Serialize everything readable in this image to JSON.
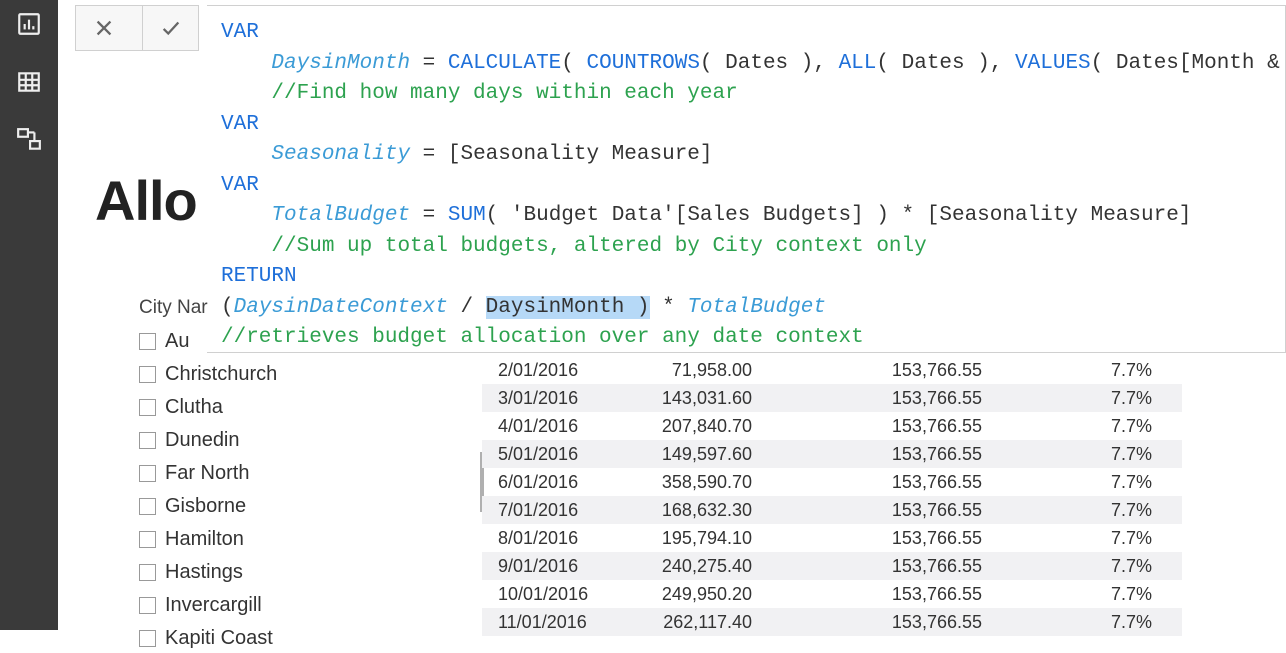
{
  "nav": {
    "report_icon": "report-icon",
    "data_icon": "data-icon",
    "model_icon": "model-icon"
  },
  "title": "Allo",
  "formula": {
    "line1_var": "VAR",
    "line2_ident": "DaysinMonth",
    "line2_eq": " = ",
    "line2_calc": "CALCULATE",
    "line2_p1": "( ",
    "line2_countrows": "COUNTROWS",
    "line2_p2": "( ",
    "line2_dates1": "Dates",
    "line2_p3": " ), ",
    "line2_all": "ALL",
    "line2_p4": "( ",
    "line2_dates2": "Dates",
    "line2_p5": " ), ",
    "line2_values": "VALUES",
    "line2_p6": "( ",
    "line2_dmref": "Dates[Month & Year]",
    "line2_end": " ) )",
    "line3_comment": "//Find how many days within each year",
    "line4_var": "VAR",
    "line5_ident": "Seasonality",
    "line5_eq": " = ",
    "line5_meas": "[Seasonality Measure]",
    "line6_var": "VAR",
    "line7_ident": "TotalBudget",
    "line7_eq": " = ",
    "line7_sum": "SUM",
    "line7_p1": "( ",
    "line7_ref": "'Budget Data'[Sales Budgets]",
    "line7_p2": " ) * ",
    "line7_meas": "[Seasonality Measure]",
    "line8_comment": "//Sum up total budgets, altered by City context only",
    "line9_return": "RETURN",
    "line10_p1": "(",
    "line10_a": "DaysinDateContext",
    "line10_div": " / ",
    "line10_b_hl": "DaysinMonth )",
    "line10_mul": " * ",
    "line10_c": "TotalBudget",
    "line11_comment": "//retrieves budget allocation over any date context"
  },
  "slicer": {
    "label": "City Nar",
    "items": [
      "Au",
      "Christchurch",
      "Clutha",
      "Dunedin",
      "Far North",
      "Gisborne",
      "Hamilton",
      "Hastings",
      "Invercargill",
      "Kapiti Coast"
    ]
  },
  "table": {
    "rows": [
      {
        "date": "2/01/2016",
        "v1": "71,958.00",
        "v2": "153,766.55",
        "v3": "7.7%"
      },
      {
        "date": "3/01/2016",
        "v1": "143,031.60",
        "v2": "153,766.55",
        "v3": "7.7%"
      },
      {
        "date": "4/01/2016",
        "v1": "207,840.70",
        "v2": "153,766.55",
        "v3": "7.7%"
      },
      {
        "date": "5/01/2016",
        "v1": "149,597.60",
        "v2": "153,766.55",
        "v3": "7.7%"
      },
      {
        "date": "6/01/2016",
        "v1": "358,590.70",
        "v2": "153,766.55",
        "v3": "7.7%"
      },
      {
        "date": "7/01/2016",
        "v1": "168,632.30",
        "v2": "153,766.55",
        "v3": "7.7%"
      },
      {
        "date": "8/01/2016",
        "v1": "195,794.10",
        "v2": "153,766.55",
        "v3": "7.7%"
      },
      {
        "date": "9/01/2016",
        "v1": "240,275.40",
        "v2": "153,766.55",
        "v3": "7.7%"
      },
      {
        "date": "10/01/2016",
        "v1": "249,950.20",
        "v2": "153,766.55",
        "v3": "7.7%"
      },
      {
        "date": "11/01/2016",
        "v1": "262,117.40",
        "v2": "153,766.55",
        "v3": "7.7%"
      }
    ]
  }
}
